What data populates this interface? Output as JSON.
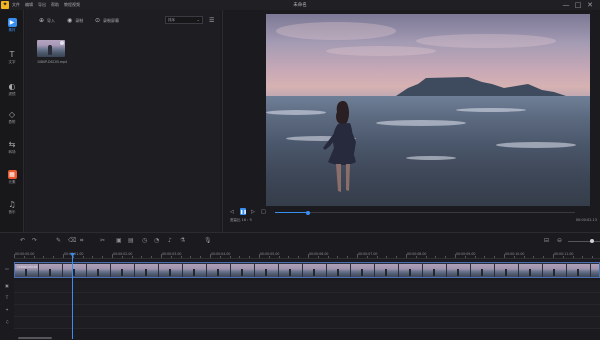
{
  "titlebar": {
    "logo": "✦",
    "menu": [
      "文件",
      "编辑",
      "导出",
      "帮助",
      "教程视频"
    ],
    "title": "未命名",
    "controls": [
      "—",
      "□",
      "✕"
    ]
  },
  "rail": [
    {
      "label": "素材",
      "icon": "media-icon",
      "active": true
    },
    {
      "label": "文字",
      "icon": "text-icon"
    },
    {
      "label": "滤镜",
      "icon": "filter-icon"
    },
    {
      "label": "叠附",
      "icon": "overlay-icon"
    },
    {
      "label": "转场",
      "icon": "transition-icon"
    },
    {
      "label": "元素",
      "icon": "elements-icon",
      "hot": true
    },
    {
      "label": "音乐",
      "icon": "music-icon"
    }
  ],
  "media": {
    "import_label": "导入",
    "record_label": "录制",
    "screen_label": "录制屏幕",
    "sort_value": "排序",
    "file_name": "1080P-DSC05.mp4"
  },
  "preview": {
    "time_left": "00:00:00.00 / 00:00:02.13",
    "time_right": "00:00:02.13",
    "progress": 0.11,
    "aspect_label": "宽高比 16 : 9"
  },
  "timeline": {
    "ticks": [
      "00:00:00.00",
      "00:00:01.00",
      "00:00:02.00",
      "00:00:03.00",
      "00:00:04.00",
      "00:00:05.00",
      "00:00:06.00",
      "00:00:07.00",
      "00:00:08.00",
      "00:00:09.00",
      "00:00:10.00",
      "00:00:11.00"
    ],
    "clip_name": "1080P-DSC05"
  },
  "colors": {
    "accent": "#3a8ef0",
    "background": "#1b1b1f",
    "logo": "#f0b51f",
    "hot": "#e8592f"
  }
}
